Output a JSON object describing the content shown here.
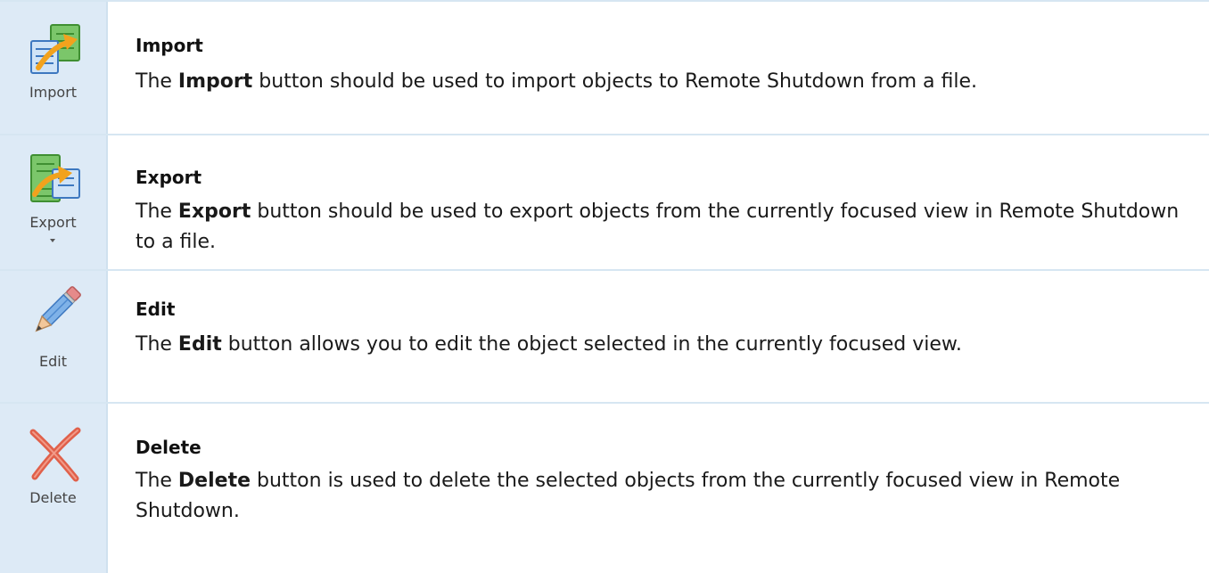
{
  "rows": [
    {
      "button_label": "Import",
      "icon": "import-icon",
      "heading": "Import",
      "desc_prefix": "The ",
      "desc_bold": "Import",
      "desc_suffix": " button should be used to import objects to Remote Shutdown from a file."
    },
    {
      "button_label": "Export",
      "icon": "export-icon",
      "has_dropdown": true,
      "heading": "Export",
      "desc_prefix": "The ",
      "desc_bold": "Export",
      "desc_suffix": " button should be used to export objects from the currently focused view in Remote Shutdown to a file."
    },
    {
      "button_label": "Edit",
      "icon": "pencil-icon",
      "heading": "Edit",
      "desc_prefix": "The ",
      "desc_bold": "Edit",
      "desc_suffix": " button allows you to edit the object selected in the currently focused view."
    },
    {
      "button_label": "Delete",
      "icon": "delete-x-icon",
      "heading": "Delete",
      "desc_prefix": "The ",
      "desc_bold": "Delete",
      "desc_suffix": " button is used to delete the selected objects from the currently focused view in Remote Shutdown."
    }
  ],
  "colors": {
    "icon_column_bg": "#ddeaf6",
    "row_border": "#d6e6f2",
    "text": "#1a1a1a",
    "delete_red": "#e0604a",
    "arrow_orange": "#f2a21d",
    "doc_blue": "#3d78c0",
    "doc_green": "#5fb447"
  }
}
